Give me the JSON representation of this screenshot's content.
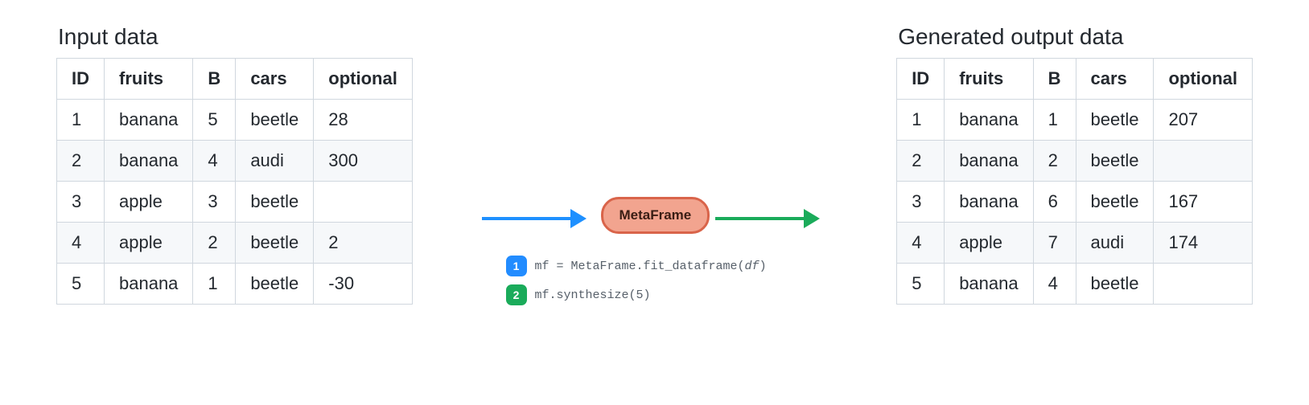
{
  "input": {
    "title": "Input data",
    "headers": [
      "ID",
      "fruits",
      "B",
      "cars",
      "optional"
    ],
    "rows": [
      {
        "id": "1",
        "fruits": "banana",
        "b": "5",
        "cars": "beetle",
        "optional": "28"
      },
      {
        "id": "2",
        "fruits": "banana",
        "b": "4",
        "cars": "audi",
        "optional": "300"
      },
      {
        "id": "3",
        "fruits": "apple",
        "b": "3",
        "cars": "beetle",
        "optional": ""
      },
      {
        "id": "4",
        "fruits": "apple",
        "b": "2",
        "cars": "beetle",
        "optional": "2"
      },
      {
        "id": "5",
        "fruits": "banana",
        "b": "1",
        "cars": "beetle",
        "optional": "-30"
      }
    ]
  },
  "output": {
    "title": "Generated output data",
    "headers": [
      "ID",
      "fruits",
      "B",
      "cars",
      "optional"
    ],
    "rows": [
      {
        "id": "1",
        "fruits": "banana",
        "b": "1",
        "cars": "beetle",
        "optional": "207"
      },
      {
        "id": "2",
        "fruits": "banana",
        "b": "2",
        "cars": "beetle",
        "optional": ""
      },
      {
        "id": "3",
        "fruits": "banana",
        "b": "6",
        "cars": "beetle",
        "optional": "167"
      },
      {
        "id": "4",
        "fruits": "apple",
        "b": "7",
        "cars": "audi",
        "optional": "174"
      },
      {
        "id": "5",
        "fruits": "banana",
        "b": "4",
        "cars": "beetle",
        "optional": ""
      }
    ]
  },
  "process": {
    "label": "MetaFrame",
    "steps": [
      {
        "n": "1",
        "code_prefix": "mf = MetaFrame.fit_dataframe(",
        "arg": "df",
        "code_suffix": ")"
      },
      {
        "n": "2",
        "code_prefix": "mf.synthesize(5)",
        "arg": "",
        "code_suffix": ""
      }
    ]
  }
}
